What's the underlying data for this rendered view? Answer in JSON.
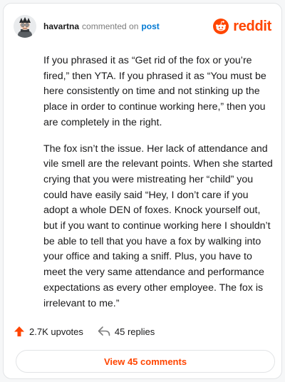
{
  "header": {
    "username": "havartna",
    "action_text": "commented on",
    "post_link": "post",
    "brand_name": "reddit",
    "brand_color": "#ff4500"
  },
  "comment": {
    "paragraphs": [
      "If you phrased it as “Get rid of the fox or you’re fired,” then YTA. If you phrased it as “You must be here consistently on time and not stinking up the place in order to continue working here,” then you are completely in the right.",
      "The fox isn’t the issue. Her lack of attendance and vile smell are the relevant points. When she started crying that you were mistreating her “child” you could have easily said “Hey, I don’t care if you adopt a whole DEN of foxes. Knock yourself out, but if you want to continue working here I shouldn’t be able to tell that you have a fox by walking into your office and taking a sniff. Plus, you have to meet the very same attendance and performance expectations as every other employee. The fox is irrelevant to me.”"
    ]
  },
  "stats": {
    "upvotes": "2.7K upvotes",
    "replies": "45 replies",
    "upvote_icon": "upvote-arrow-icon",
    "reply_icon": "reply-arrow-icon"
  },
  "footer": {
    "view_comments_label": "View 45 comments"
  }
}
